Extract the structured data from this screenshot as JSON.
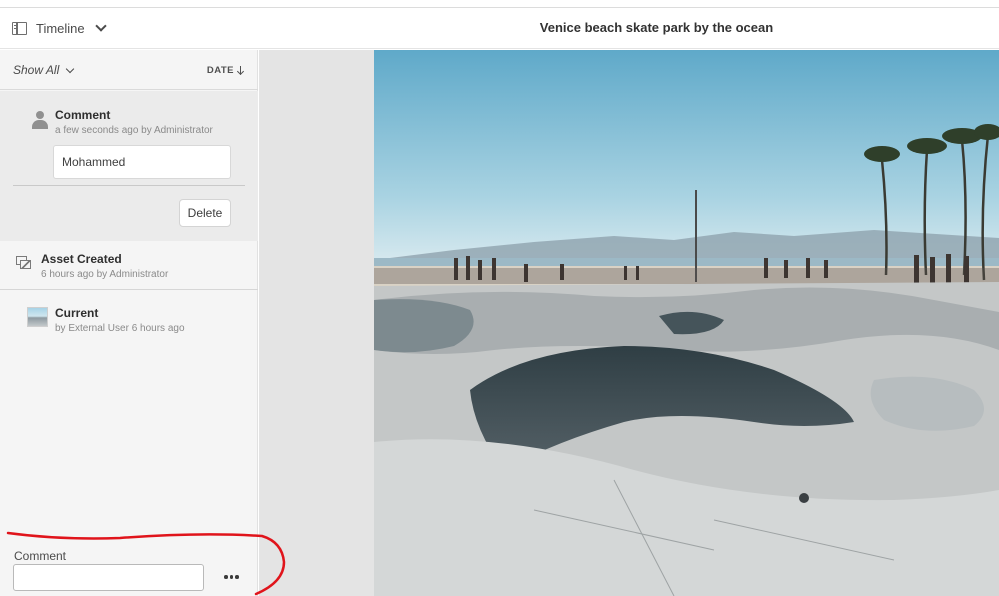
{
  "header": {
    "rail_label": "Timeline",
    "title": "Venice beach skate park by the ocean"
  },
  "rail": {
    "filter_label": "Show All",
    "sort_label": "DATE",
    "comment_entry": {
      "title": "Comment",
      "meta": "a few seconds ago by Administrator",
      "text": "Mohammed",
      "delete_label": "Delete"
    },
    "events": [
      {
        "title": "Asset Created",
        "meta": "6 hours ago by Administrator",
        "icon": "asset-created-icon"
      },
      {
        "title": "Current",
        "meta": "by External User 6 hours ago",
        "icon": "asset-thumbnail"
      }
    ],
    "compose": {
      "label": "Comment",
      "value": "",
      "more_icon": "ellipsis-icon"
    }
  },
  "colors": {
    "rail_bg": "#f5f5f5",
    "comment_card_bg": "#ebebeb",
    "annotation_stroke": "#e0141b",
    "sky": "#8cc6db",
    "concrete": "#b8bdbe"
  }
}
